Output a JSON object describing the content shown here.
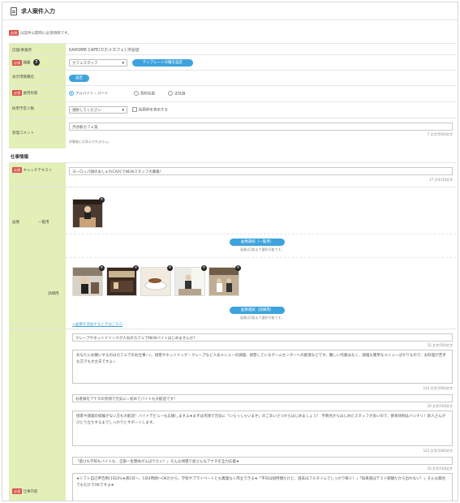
{
  "header": {
    "title": "求人案件入力"
  },
  "required_badge": "必須",
  "notice": {
    "text": "は案件公開時に必須項目です。"
  },
  "store": {
    "label": "店舗/事業所",
    "value": "KAHOME CAFE(カホメカフェ) 渋谷店"
  },
  "job_type": {
    "label": "職種",
    "select_value": "カフェスタッフ",
    "template_button": "テンプレートの雛を設定"
  },
  "display_job_name": {
    "label": "表示用職種名",
    "button": "設定"
  },
  "employment": {
    "label": "雇用形態",
    "options": [
      "アルバイト・パート",
      "契約社員",
      "正社員"
    ],
    "selected": 0
  },
  "hires": {
    "label": "採用予定人数",
    "select_value": "選択してください",
    "checkbox_label": "採用枠を表示する"
  },
  "admin_comment": {
    "label": "管理コメント",
    "value": "渋谷駅カフェ案",
    "counter": "7 文字/5000文字",
    "hint": "求職者には表示されません。"
  },
  "job_info": {
    "heading": "仕事情報"
  },
  "catch": {
    "label": "キャッチテキスト",
    "value": "ヨーロッパ調のおしゃれCAFEでNEWスタッフ大募集！",
    "counter": "27 文字/30文字"
  },
  "image": {
    "label": "画像",
    "list_label": "一覧用",
    "detail_label": "詳細用",
    "select_list_button": "画像選択（一覧用）",
    "select_list_hint": "画像は1枚まで選択可能です。",
    "select_detail_button": "画像選択（詳細用）",
    "select_detail_hint": "画像は5枚まで選択可能です。",
    "add_link": "+画像を追加するときはこちら"
  },
  "job_content": {
    "label": "仕事内容",
    "blocks": [
      {
        "title": "クレープやホットドリンクが人気のカフェでNEWバイトはじめませんか？",
        "title_count": "32 文字/100文字",
        "body": "あなたにお願いするのはカフェでのお仕事☆♪。接客やホットドッグ・クレープなど人気メニューの調理、接客しているゲームセンターへの配達などです。難しい作業はなく、調理も簡単なメニューばかりなので、お料理が苦手な方でも大丈夫ですよ☆",
        "body_count": "114 文字/1000文字"
      },
      {
        "title": "お客様をアナタの笑顔で元気に☆初めてバイトも大歓迎です！",
        "title_count": "29 文字/100文字",
        "body": "接客や調理の経験がない方も大歓迎！バイトデビューも応援しますよ★まずは笑顔で元気に「いらっしゃいませ」のごあいさつからはじめましょう！ 不明点からはじめたスタッフが多いので、教育体制はバッチリ！新人さんがひとり立ちするまでしっかりとサポートします。",
        "body_count": "123 文字/1000文字"
      },
      {
        "title": "「遊びも学校もバイトも…全部一生懸命がんばりたい！」そんな頑張り屋さんなアナタを全力応援★",
        "title_count": "45 文字/100文字",
        "body": "★シフト自己申告制(1日2h)★週1日～、1日4時間～OKだから、学校やプライベートとも無理なく両立できる★「平日は短時間だけど、週末はフルタイムでしっかり稼ぐ！」「再来週はテスト期間だから出れない！」そんな都合でもだけでOKですよ★",
        "body_count": ""
      }
    ]
  }
}
